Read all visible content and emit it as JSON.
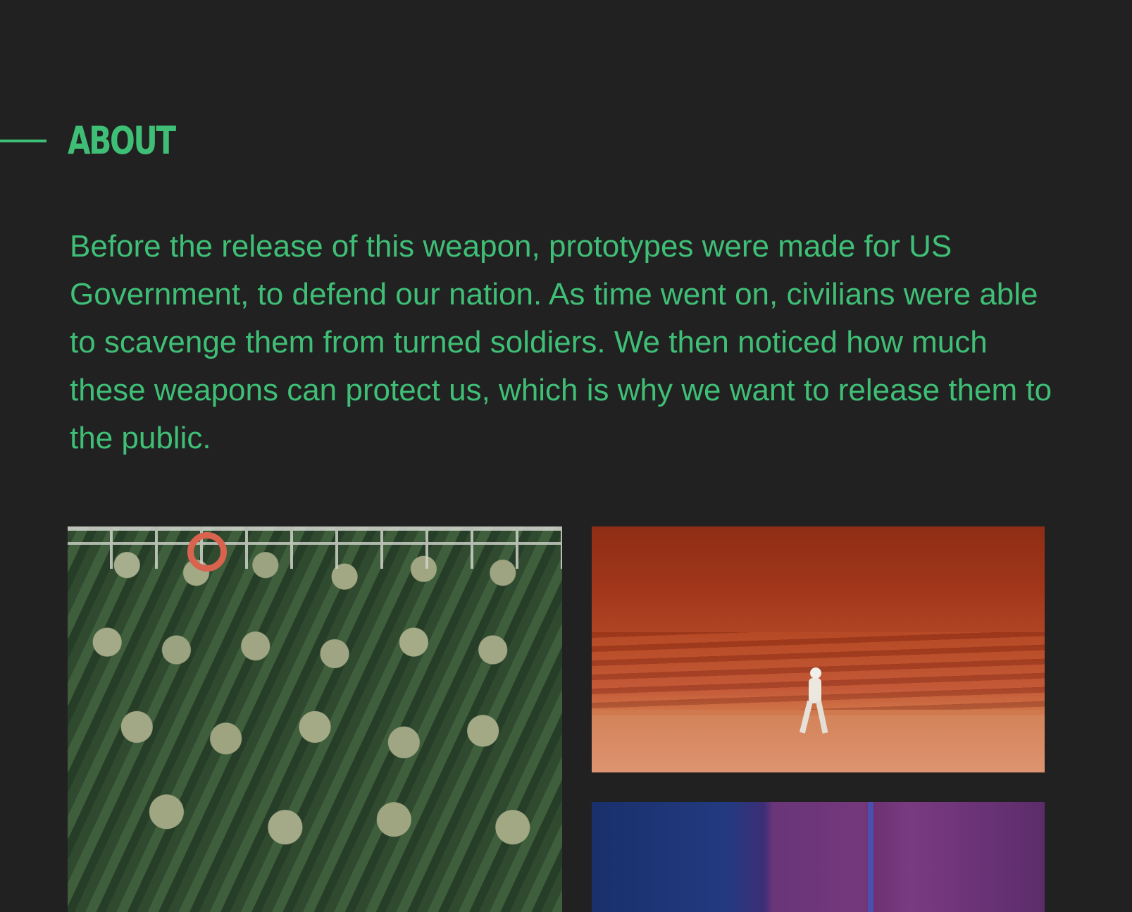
{
  "about": {
    "title": "ABOUT",
    "body": "Before the release of this weapon, prototypes were made for US Government,  to defend our nation. As time went on, civilians were able to scavenge them from turned soldiers. We then noticed how much these weapons can protect us, which is why we want to release them to the public."
  },
  "colors": {
    "background": "#212121",
    "accent": "#3fbf76"
  },
  "images": [
    {
      "name": "soldiers-photo"
    },
    {
      "name": "desert-astronaut-photo"
    },
    {
      "name": "purple-room-photo"
    }
  ]
}
